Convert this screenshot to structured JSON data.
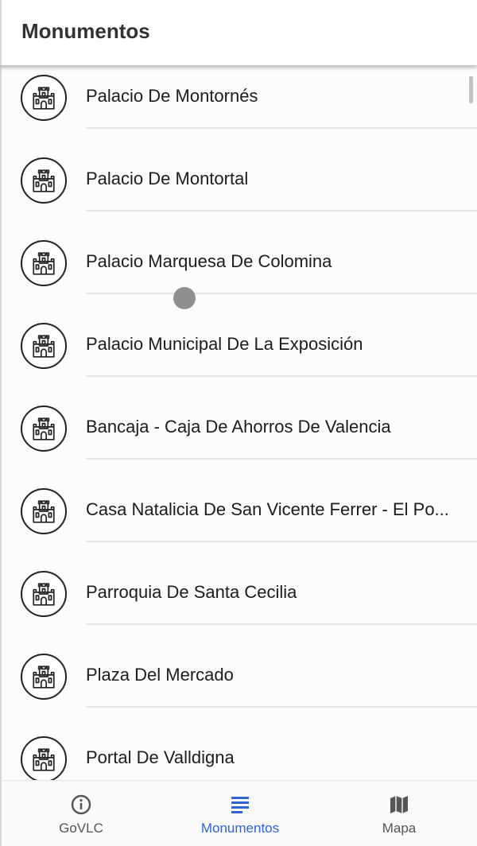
{
  "app_bar": {
    "title": "Monumentos"
  },
  "monuments": [
    {
      "name": "Palacio De Montornés",
      "icon": "castle-icon"
    },
    {
      "name": "Palacio De Montortal",
      "icon": "castle-icon"
    },
    {
      "name": "Palacio Marquesa De Colomina",
      "icon": "castle-icon"
    },
    {
      "name": "Palacio Municipal De La Exposición",
      "icon": "castle-icon"
    },
    {
      "name": "Bancaja - Caja De Ahorros De Valencia",
      "icon": "castle-icon"
    },
    {
      "name": "Casa Natalicia De San Vicente Ferrer - El Po...",
      "icon": "castle-icon"
    },
    {
      "name": "Parroquia De Santa Cecilia",
      "icon": "castle-icon"
    },
    {
      "name": "Plaza Del Mercado",
      "icon": "castle-icon"
    },
    {
      "name": "Portal De Valldigna",
      "icon": "castle-icon"
    }
  ],
  "bottom_nav": {
    "tabs": [
      {
        "label": "GoVLC",
        "icon": "info-icon",
        "active": false
      },
      {
        "label": "Monumentos",
        "icon": "list-icon",
        "active": true
      },
      {
        "label": "Mapa",
        "icon": "map-icon",
        "active": false
      }
    ]
  },
  "colors": {
    "accent": "#2f63d6",
    "inactive": "#555555",
    "divider": "#e4e4e4"
  }
}
